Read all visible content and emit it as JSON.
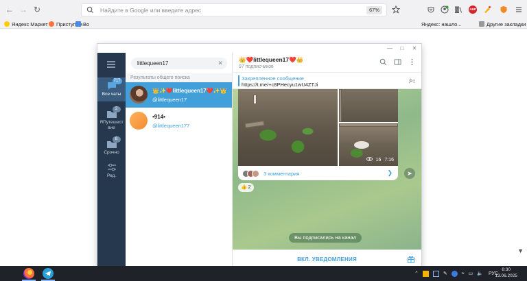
{
  "browser": {
    "address_placeholder": "Найдите в Google или введите адрес",
    "zoom": "67%",
    "bookmarks": {
      "yandex_market": "Яндекс Маркет",
      "get_started": "Приступим",
      "truncated": "Во",
      "yandex_found": "Яндекс: нашло...",
      "other_bookmarks": "Другие закладки"
    },
    "abp_label": "ABP"
  },
  "telegram": {
    "rail": {
      "all_chats": {
        "label": "Все чаты",
        "badge": "717"
      },
      "folder2": {
        "label": "ЯПутешест вие",
        "badge": "2"
      },
      "urgent": {
        "label": "Срочно",
        "badge": "8"
      },
      "edit": {
        "label": "Ред."
      }
    },
    "search": {
      "value": "littlequeen17",
      "section_title": "Результаты общего поиска"
    },
    "results": [
      {
        "name": "👑✨❤️littlequeen17❤️✨👑",
        "username": "@littlequeen17",
        "selected": true
      },
      {
        "name": "•914•",
        "username": "@littlequeen177",
        "selected": false
      }
    ],
    "chat": {
      "title": "👑❤️littlequeen17❤️👑",
      "subtitle": "97 подписчиков",
      "pinned_title": "Закреплённое сообщение",
      "pinned_link": "https://t.me/+c8PHecyu1wU4ZTJi",
      "views": "16",
      "time": "7:16",
      "comments": "3 комментария",
      "reaction_emoji": "👍",
      "reaction_count": "2",
      "service_message": "Вы подписались на канал",
      "notify_button": "ВКЛ. УВЕДОМЛЕНИЯ"
    }
  },
  "taskbar": {
    "lang": "РУС",
    "time": "8:30",
    "date": "13.06.2025"
  }
}
